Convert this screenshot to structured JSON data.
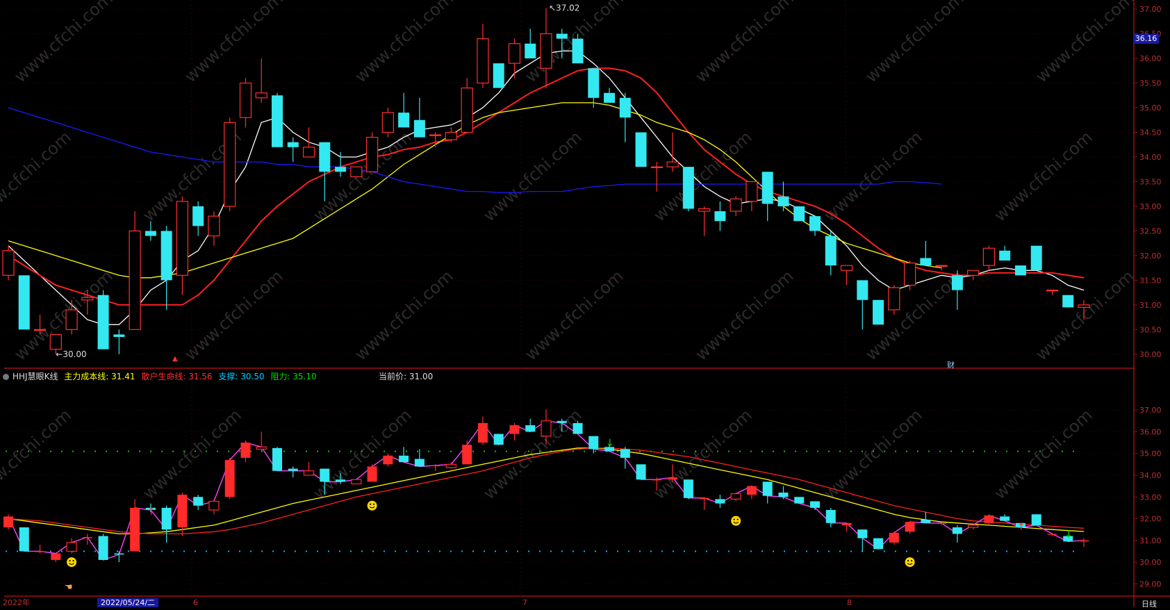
{
  "chart_data": {
    "type": "candlestick",
    "watermark": "www.cfchi.com",
    "upper": {
      "ylim": [
        29.8,
        37.1
      ],
      "ticks": [
        "30.00",
        "30.50",
        "31.00",
        "31.50",
        "32.00",
        "32.50",
        "33.00",
        "33.50",
        "34.00",
        "34.50",
        "35.00",
        "35.50",
        "36.00",
        "36.50",
        "37.00"
      ],
      "current_price_tag": "36.16",
      "high_label": "37.02",
      "low_label": "30.00",
      "marker_label": "财"
    },
    "lower": {
      "ylim": [
        28.5,
        37.9
      ],
      "ticks": [
        "29.00",
        "30.00",
        "31.00",
        "32.00",
        "33.00",
        "34.00",
        "35.00",
        "36.00",
        "37.00"
      ],
      "legend": {
        "title": "HHJ慧眼K线",
        "items": [
          {
            "label": "主力成本线: 31.41",
            "color": "#ffff00"
          },
          {
            "label": "散户生命线: 31.56",
            "color": "#ff2020"
          },
          {
            "label": "支撑: 30.50",
            "color": "#00ccff"
          },
          {
            "label": "阻力: 35.10",
            "color": "#00dd00"
          }
        ]
      },
      "current_price": "当前价: 31.00",
      "support": 30.5,
      "resistance": 35.1
    },
    "x_axis": {
      "labels": [
        "2022年",
        "6",
        "7",
        "8"
      ],
      "selected_date": "2022/05/24/二",
      "period": "日线"
    },
    "candles": [
      {
        "o": 31.6,
        "h": 32.2,
        "l": 31.5,
        "c": 32.1
      },
      {
        "o": 31.6,
        "h": 31.6,
        "l": 30.6,
        "c": 30.5
      },
      {
        "o": 30.5,
        "h": 30.8,
        "l": 30.4,
        "c": 30.5
      },
      {
        "o": 30.1,
        "h": 30.4,
        "l": 30.0,
        "c": 30.4
      },
      {
        "o": 30.5,
        "h": 31.1,
        "l": 30.4,
        "c": 30.9
      },
      {
        "o": 31.1,
        "h": 31.3,
        "l": 30.8,
        "c": 31.15
      },
      {
        "o": 31.2,
        "h": 31.3,
        "l": 30.1,
        "c": 30.1
      },
      {
        "o": 30.4,
        "h": 30.5,
        "l": 30.0,
        "c": 30.35
      },
      {
        "o": 30.5,
        "h": 32.9,
        "l": 30.5,
        "c": 32.5
      },
      {
        "o": 32.5,
        "h": 32.7,
        "l": 32.3,
        "c": 32.4
      },
      {
        "o": 32.5,
        "h": 32.6,
        "l": 30.9,
        "c": 31.5
      },
      {
        "o": 31.6,
        "h": 33.2,
        "l": 31.2,
        "c": 33.1
      },
      {
        "o": 33.0,
        "h": 33.1,
        "l": 32.4,
        "c": 32.6
      },
      {
        "o": 32.4,
        "h": 32.9,
        "l": 32.2,
        "c": 32.8
      },
      {
        "o": 33.0,
        "h": 34.8,
        "l": 32.9,
        "c": 34.7
      },
      {
        "o": 34.8,
        "h": 35.6,
        "l": 34.6,
        "c": 35.5
      },
      {
        "o": 35.2,
        "h": 36.0,
        "l": 35.1,
        "c": 35.3
      },
      {
        "o": 35.25,
        "h": 35.3,
        "l": 34.2,
        "c": 34.2
      },
      {
        "o": 34.3,
        "h": 34.4,
        "l": 33.9,
        "c": 34.2
      },
      {
        "o": 34.0,
        "h": 34.6,
        "l": 34.0,
        "c": 34.2
      },
      {
        "o": 34.3,
        "h": 34.3,
        "l": 33.1,
        "c": 33.7
      },
      {
        "o": 33.8,
        "h": 34.1,
        "l": 33.6,
        "c": 33.7
      },
      {
        "o": 33.6,
        "h": 33.6,
        "l": 33.6,
        "c": 33.8
      },
      {
        "o": 33.7,
        "h": 34.5,
        "l": 33.7,
        "c": 34.4
      },
      {
        "o": 34.5,
        "h": 35.0,
        "l": 34.4,
        "c": 34.9
      },
      {
        "o": 34.9,
        "h": 35.3,
        "l": 34.7,
        "c": 34.6
      },
      {
        "o": 34.75,
        "h": 35.2,
        "l": 34.6,
        "c": 34.4
      },
      {
        "o": 34.45,
        "h": 34.5,
        "l": 34.2,
        "c": 34.45
      },
      {
        "o": 34.35,
        "h": 34.6,
        "l": 34.3,
        "c": 34.5
      },
      {
        "o": 34.5,
        "h": 35.6,
        "l": 34.5,
        "c": 35.4
      },
      {
        "o": 35.5,
        "h": 36.7,
        "l": 35.4,
        "c": 36.4
      },
      {
        "o": 35.9,
        "h": 35.9,
        "l": 35.4,
        "c": 35.4
      },
      {
        "o": 35.9,
        "h": 36.4,
        "l": 35.6,
        "c": 36.3
      },
      {
        "o": 36.3,
        "h": 36.6,
        "l": 36.1,
        "c": 36.0
      },
      {
        "o": 35.8,
        "h": 37.02,
        "l": 35.4,
        "c": 36.5
      },
      {
        "o": 36.5,
        "h": 36.6,
        "l": 36.0,
        "c": 36.4
      },
      {
        "o": 36.4,
        "h": 36.5,
        "l": 36.0,
        "c": 35.9
      },
      {
        "o": 35.8,
        "h": 35.8,
        "l": 35.0,
        "c": 35.2
      },
      {
        "o": 35.3,
        "h": 35.4,
        "l": 35.1,
        "c": 35.1
      },
      {
        "o": 35.2,
        "h": 35.3,
        "l": 34.3,
        "c": 34.8
      },
      {
        "o": 34.5,
        "h": 34.5,
        "l": 33.8,
        "c": 33.8
      },
      {
        "o": 33.8,
        "h": 33.9,
        "l": 33.3,
        "c": 33.8
      },
      {
        "o": 33.8,
        "h": 34.5,
        "l": 33.7,
        "c": 33.9
      },
      {
        "o": 33.8,
        "h": 33.8,
        "l": 32.9,
        "c": 32.95
      },
      {
        "o": 32.9,
        "h": 33.0,
        "l": 32.4,
        "c": 32.95
      },
      {
        "o": 32.9,
        "h": 33.1,
        "l": 32.5,
        "c": 32.7
      },
      {
        "o": 32.9,
        "h": 33.2,
        "l": 32.8,
        "c": 33.15
      },
      {
        "o": 33.1,
        "h": 33.5,
        "l": 32.9,
        "c": 33.5
      },
      {
        "o": 33.7,
        "h": 33.7,
        "l": 32.7,
        "c": 33.05
      },
      {
        "o": 33.2,
        "h": 33.5,
        "l": 32.9,
        "c": 33.0
      },
      {
        "o": 33.0,
        "h": 33.0,
        "l": 32.7,
        "c": 32.7
      },
      {
        "o": 32.8,
        "h": 32.8,
        "l": 32.4,
        "c": 32.5
      },
      {
        "o": 32.4,
        "h": 32.5,
        "l": 31.6,
        "c": 31.8
      },
      {
        "o": 31.7,
        "h": 31.8,
        "l": 31.4,
        "c": 31.8
      },
      {
        "o": 31.5,
        "h": 31.5,
        "l": 30.5,
        "c": 31.1
      },
      {
        "o": 31.1,
        "h": 31.1,
        "l": 30.6,
        "c": 30.6
      },
      {
        "o": 30.9,
        "h": 31.4,
        "l": 30.8,
        "c": 31.35
      },
      {
        "o": 31.4,
        "h": 31.9,
        "l": 31.3,
        "c": 31.85
      },
      {
        "o": 31.95,
        "h": 32.3,
        "l": 31.8,
        "c": 31.8
      },
      {
        "o": 31.8,
        "h": 31.8,
        "l": 31.7,
        "c": 31.8
      },
      {
        "o": 31.6,
        "h": 31.7,
        "l": 30.9,
        "c": 31.3
      },
      {
        "o": 31.6,
        "h": 31.7,
        "l": 31.5,
        "c": 31.7
      },
      {
        "o": 31.8,
        "h": 32.2,
        "l": 31.7,
        "c": 32.15
      },
      {
        "o": 32.1,
        "h": 32.2,
        "l": 31.9,
        "c": 31.9
      },
      {
        "o": 31.8,
        "h": 31.8,
        "l": 31.6,
        "c": 31.6
      },
      {
        "o": 32.2,
        "h": 32.2,
        "l": 31.7,
        "c": 31.7
      },
      {
        "o": 31.3,
        "h": 31.3,
        "l": 31.2,
        "c": 31.3
      },
      {
        "o": 31.2,
        "h": 31.2,
        "l": 30.95,
        "c": 30.95
      },
      {
        "o": 30.95,
        "h": 31.1,
        "l": 30.7,
        "c": 31.0
      }
    ],
    "series": [
      {
        "name": "MA5",
        "color": "#ffffff",
        "values": [
          32.2,
          31.9,
          31.6,
          31.3,
          31.0,
          30.7,
          30.6,
          30.6,
          30.9,
          31.3,
          31.5,
          31.9,
          32.1,
          32.6,
          33.3,
          33.8,
          34.7,
          34.8,
          34.5,
          34.3,
          34.2,
          34.0,
          34.0,
          34.1,
          34.2,
          34.4,
          34.55,
          34.6,
          34.65,
          34.8,
          35.0,
          35.3,
          35.7,
          35.9,
          36.1,
          36.15,
          36.15,
          35.9,
          35.6,
          35.2,
          34.8,
          34.4,
          34.0,
          33.7,
          33.4,
          33.2,
          33.05,
          33.1,
          33.15,
          33.1,
          32.95,
          32.8,
          32.5,
          32.2,
          31.8,
          31.5,
          31.3,
          31.4,
          31.5,
          31.6,
          31.55,
          31.6,
          31.7,
          31.75,
          31.7,
          31.7,
          31.6,
          31.4,
          31.3
        ]
      },
      {
        "name": "MA10",
        "color": "#ff2020",
        "values": [
          32.0,
          31.8,
          31.6,
          31.4,
          31.3,
          31.2,
          31.1,
          31.0,
          31.0,
          31.0,
          31.0,
          31.0,
          31.2,
          31.5,
          31.9,
          32.3,
          32.7,
          33.0,
          33.25,
          33.5,
          33.65,
          33.8,
          33.9,
          34.0,
          34.05,
          34.15,
          34.2,
          34.3,
          34.35,
          34.5,
          34.7,
          34.9,
          35.1,
          35.3,
          35.45,
          35.6,
          35.75,
          35.8,
          35.8,
          35.75,
          35.6,
          35.3,
          34.9,
          34.5,
          34.15,
          33.9,
          33.65,
          33.45,
          33.3,
          33.2,
          33.1,
          33.0,
          32.85,
          32.65,
          32.4,
          32.15,
          31.95,
          31.8,
          31.7,
          31.65,
          31.6,
          31.6,
          31.65,
          31.65,
          31.65,
          31.65,
          31.65,
          31.6,
          31.55
        ]
      },
      {
        "name": "MA20",
        "color": "#ffff00",
        "values": [
          32.3,
          32.2,
          32.1,
          32.0,
          31.9,
          31.8,
          31.7,
          31.6,
          31.55,
          31.55,
          31.6,
          31.65,
          31.75,
          31.85,
          31.95,
          32.05,
          32.15,
          32.25,
          32.35,
          32.55,
          32.75,
          32.95,
          33.15,
          33.35,
          33.6,
          33.85,
          34.05,
          34.25,
          34.45,
          34.65,
          34.8,
          34.9,
          34.95,
          35.0,
          35.05,
          35.1,
          35.1,
          35.1,
          35.05,
          34.95,
          34.85,
          34.7,
          34.6,
          34.5,
          34.35,
          34.15,
          33.9,
          33.6,
          33.3,
          33.0,
          32.75,
          32.55,
          32.4,
          32.25,
          32.15,
          32.05,
          31.95,
          31.85,
          31.8,
          31.75
        ]
      },
      {
        "name": "MA60",
        "color": "#1a1aff",
        "values": [
          35.0,
          34.9,
          34.8,
          34.7,
          34.6,
          34.5,
          34.4,
          34.3,
          34.2,
          34.1,
          34.05,
          34.0,
          33.95,
          33.9,
          33.9,
          33.9,
          33.9,
          33.85,
          33.85,
          33.8,
          33.8,
          33.8,
          33.75,
          33.7,
          33.6,
          33.5,
          33.45,
          33.4,
          33.35,
          33.3,
          33.3,
          33.28,
          33.28,
          33.3,
          33.3,
          33.3,
          33.35,
          33.4,
          33.42,
          33.45,
          33.45,
          33.45,
          33.45,
          33.45,
          33.45,
          33.45,
          33.45,
          33.45,
          33.45,
          33.45,
          33.45,
          33.45,
          33.45,
          33.45,
          33.45,
          33.45,
          33.5,
          33.5,
          33.48,
          33.45
        ]
      }
    ],
    "lower_series": [
      {
        "name": "主力成本线",
        "color": "#ffff00",
        "values": [
          32.0,
          31.9,
          31.8,
          31.7,
          31.6,
          31.5,
          31.4,
          31.3,
          31.3,
          31.35,
          31.4,
          31.5,
          31.6,
          31.7,
          31.9,
          32.1,
          32.3,
          32.5,
          32.7,
          32.85,
          33.0,
          33.15,
          33.3,
          33.45,
          33.6,
          33.75,
          33.9,
          34.05,
          34.2,
          34.35,
          34.5,
          34.65,
          34.8,
          34.95,
          35.05,
          35.15,
          35.25,
          35.25,
          35.2,
          35.1,
          35.0,
          34.85,
          34.7,
          34.55,
          34.4,
          34.25,
          34.1,
          33.95,
          33.8,
          33.6,
          33.4,
          33.2,
          33.0,
          32.8,
          32.6,
          32.4,
          32.2,
          32.05,
          31.95,
          31.85,
          31.8,
          31.75,
          31.7,
          31.65,
          31.6,
          31.55,
          31.5,
          31.45,
          31.41
        ]
      },
      {
        "name": "散户生命线",
        "color": "#ff2020",
        "values": [
          32.0,
          31.95,
          31.9,
          31.8,
          31.7,
          31.6,
          31.5,
          31.4,
          31.35,
          31.3,
          31.3,
          31.3,
          31.35,
          31.4,
          31.5,
          31.65,
          31.8,
          32.0,
          32.2,
          32.4,
          32.6,
          32.8,
          33.0,
          33.15,
          33.3,
          33.45,
          33.6,
          33.75,
          33.9,
          34.05,
          34.2,
          34.4,
          34.6,
          34.8,
          34.95,
          35.1,
          35.2,
          35.25,
          35.25,
          35.2,
          35.15,
          35.05,
          34.95,
          34.85,
          34.7,
          34.55,
          34.4,
          34.25,
          34.1,
          33.95,
          33.8,
          33.6,
          33.4,
          33.2,
          33.0,
          32.8,
          32.6,
          32.45,
          32.3,
          32.15,
          32.0,
          31.9,
          31.85,
          31.8,
          31.75,
          31.7,
          31.65,
          31.6,
          31.56
        ]
      }
    ],
    "signals": [
      {
        "type": "arrow-up",
        "idx": 9,
        "color": "#ff3030"
      },
      {
        "type": "arrow-down",
        "idx": 38,
        "color": "#00dd00"
      },
      {
        "type": "arrow-up",
        "idx": 64,
        "color": "#ff3030"
      },
      {
        "type": "arrow-down",
        "idx": 67,
        "color": "#00dd00"
      },
      {
        "type": "smiley",
        "idx": 4,
        "price": 30.0
      },
      {
        "type": "smiley",
        "idx": 23,
        "price": 32.6
      },
      {
        "type": "smiley",
        "idx": 46,
        "price": 31.9
      },
      {
        "type": "smiley",
        "idx": 57,
        "price": 30.0
      }
    ]
  }
}
